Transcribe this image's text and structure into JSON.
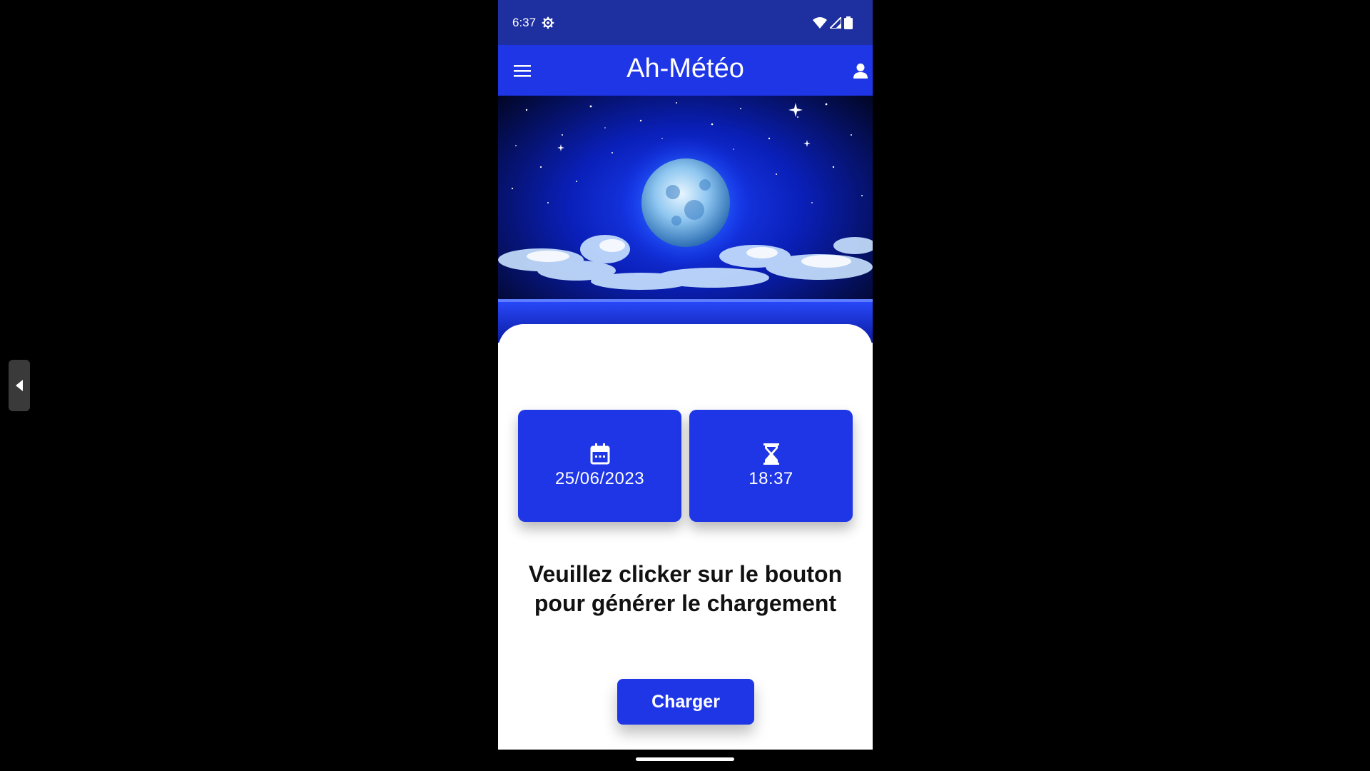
{
  "status_bar": {
    "time": "6:37",
    "icons": [
      "gear-icon",
      "wifi-icon",
      "cell-signal-icon",
      "battery-icon"
    ]
  },
  "app_bar": {
    "title": "Ah-Météo",
    "menu_icon": "hamburger-menu-icon",
    "profile_icon": "user-icon"
  },
  "hero_image": {
    "description_icon": "moon-night-sky-illustration"
  },
  "tiles": {
    "date": {
      "icon": "calendar-icon",
      "value": "25/06/2023"
    },
    "time": {
      "icon": "hourglass-icon",
      "value": "18:37"
    }
  },
  "message": {
    "line1": "Veuillez clicker sur le bouton",
    "line2": "pour générer le chargement"
  },
  "actions": {
    "charger_label": "Charger"
  },
  "colors": {
    "status_bar": "#1e2fa0",
    "primary": "#1f36e6",
    "background": "#000000",
    "sheet": "#ffffff",
    "text": "#111111"
  }
}
